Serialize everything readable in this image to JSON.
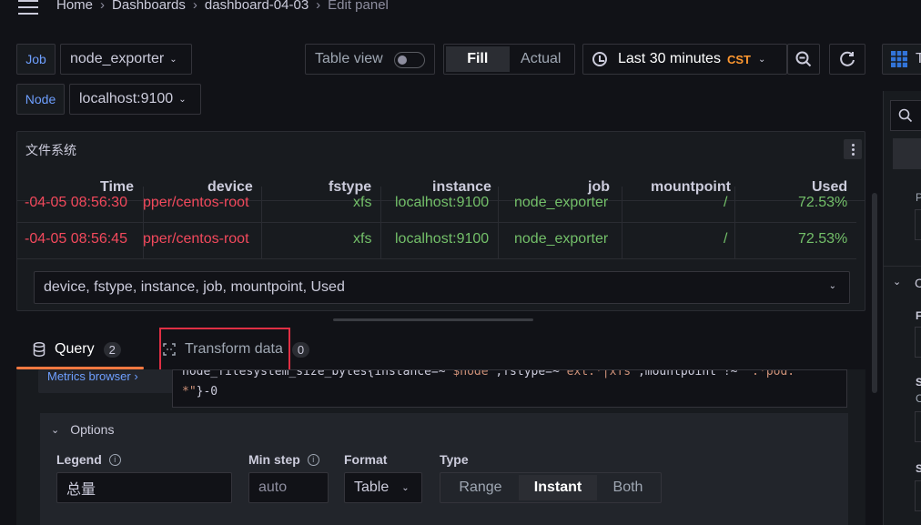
{
  "breadcrumbs": {
    "home": "Home",
    "dashboards": "Dashboards",
    "dashboard": "dashboard-04-03",
    "current": "Edit panel",
    "separator": "›"
  },
  "variables": {
    "job_label": "Job",
    "job_value": "node_exporter",
    "node_label": "Node",
    "node_value": "localhost:9100"
  },
  "toolbar": {
    "table_view": "Table view",
    "fill": "Fill",
    "actual": "Actual",
    "time_range": "Last 30 minutes",
    "timezone": "CST"
  },
  "panel": {
    "title": "文件系统",
    "columns": [
      "Time",
      "device",
      "fstype",
      "instance",
      "job",
      "mountpoint",
      "Used"
    ],
    "rows": [
      [
        "-04-05 08:56:30",
        "pper/centos-root",
        "xfs",
        "localhost:9100",
        "node_exporter",
        "/",
        "72.53%"
      ],
      [
        "-04-05 08:56:45",
        "pper/centos-root",
        "xfs",
        "localhost:9100",
        "node_exporter",
        "/",
        "72.53%"
      ]
    ],
    "column_select": "device, fstype, instance, job, mountpoint, Used"
  },
  "tabs": {
    "query_label": "Query",
    "query_count": "2",
    "transform_label": "Transform data",
    "transform_count": "0"
  },
  "query": {
    "metrics_browser": "Metrics browser ›",
    "code_line1_a": "node_filesystem_size_bytes{instance=~",
    "code_line1_b": "\"$node\"",
    "code_line1_c": ",fstype=~",
    "code_line1_d": "\"ext.*|xfs\"",
    "code_line1_e": ",mountpoint !~ ",
    "code_line1_f": "\".*pod.",
    "code_line2_a": "*\"",
    "code_line2_b": "}-0"
  },
  "options": {
    "header": "Options",
    "legend_label": "Legend",
    "legend_value": "总量",
    "minstep_label": "Min step",
    "minstep_placeholder": "auto",
    "format_label": "Format",
    "format_value": "Table",
    "type_label": "Type",
    "type_options": [
      "Range",
      "Instant",
      "Both"
    ]
  },
  "right_side": {
    "letters": [
      "T",
      "P",
      "C",
      "F",
      "S",
      "C",
      "S"
    ]
  },
  "colors": {
    "accent_orange": "#ff7941",
    "value_red": "#f2495c",
    "value_green": "#73bf69",
    "link_blue": "#6e9fff",
    "highlight_box": "#e02f44"
  }
}
